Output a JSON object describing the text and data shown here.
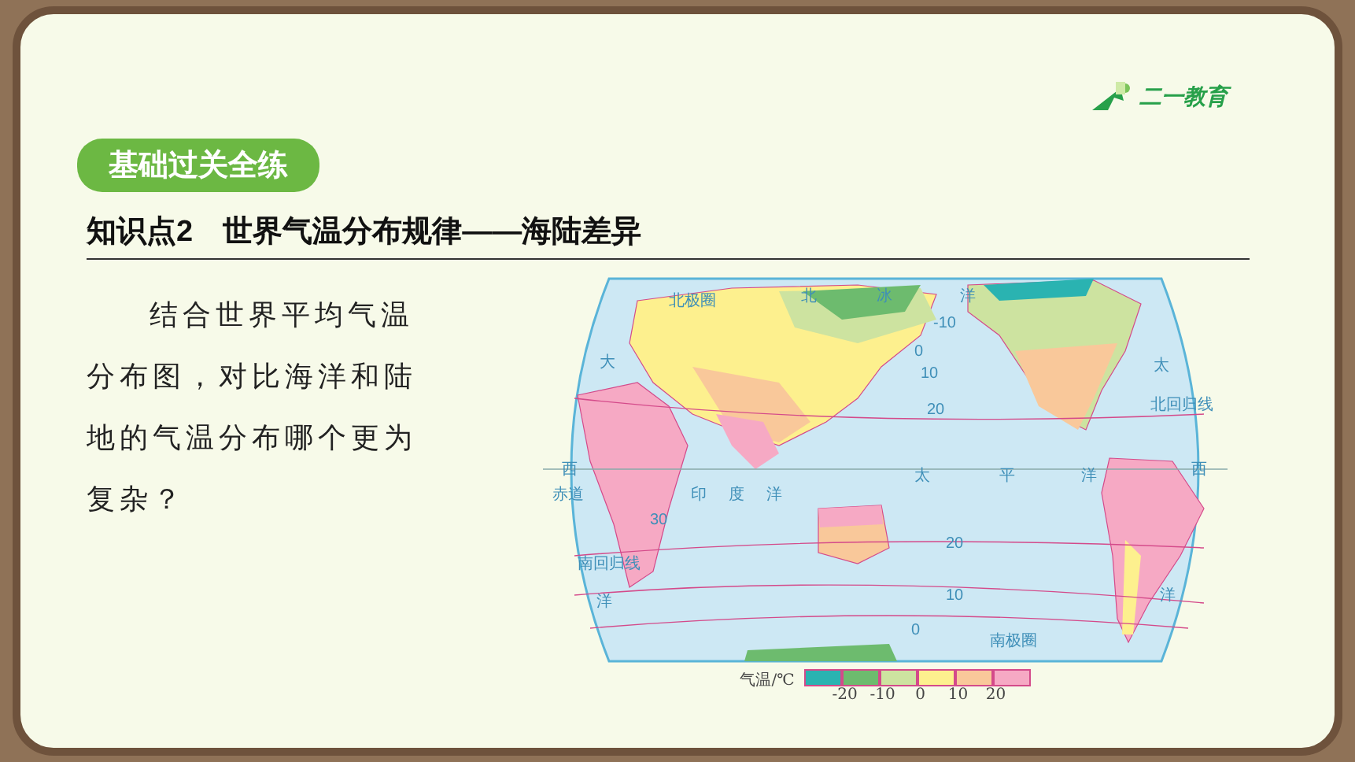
{
  "logo": {
    "text": "二一教育"
  },
  "banner": {
    "text": "基础过关全练"
  },
  "heading": "知识点2　世界气温分布规律——海陆差异",
  "question": [
    "结合世界平均气温",
    "分布图，对比海洋和陆",
    "地的气温分布哪个更为",
    "复杂？"
  ],
  "map": {
    "labels": [
      {
        "text": "北极圈"
      },
      {
        "text": "北"
      },
      {
        "text": "冰"
      },
      {
        "text": "洋"
      },
      {
        "text": "大"
      },
      {
        "text": "太"
      },
      {
        "text": "北回归线"
      },
      {
        "text": "西"
      },
      {
        "text": "太"
      },
      {
        "text": "平"
      },
      {
        "text": "洋"
      },
      {
        "text": "西"
      },
      {
        "text": "赤道"
      },
      {
        "text": "印"
      },
      {
        "text": "度"
      },
      {
        "text": "洋"
      },
      {
        "text": "南回归线"
      },
      {
        "text": "洋"
      },
      {
        "text": "洋"
      },
      {
        "text": "南极圈"
      },
      {
        "text": "-10"
      },
      {
        "text": "0"
      },
      {
        "text": "10"
      },
      {
        "text": "20"
      },
      {
        "text": "30"
      },
      {
        "text": "20"
      },
      {
        "text": "10"
      },
      {
        "text": "0"
      }
    ],
    "legend": {
      "title": "气温/℃",
      "colors": [
        {
          "color": "#2ab3b1"
        },
        {
          "color": "#6dbb6e"
        },
        {
          "color": "#cde3a0"
        },
        {
          "color": "#fdf08e"
        },
        {
          "color": "#f9c89a"
        },
        {
          "color": "#f6a9c4"
        }
      ],
      "ticks": [
        "-20",
        "-10",
        "0",
        "10",
        "20"
      ]
    }
  }
}
